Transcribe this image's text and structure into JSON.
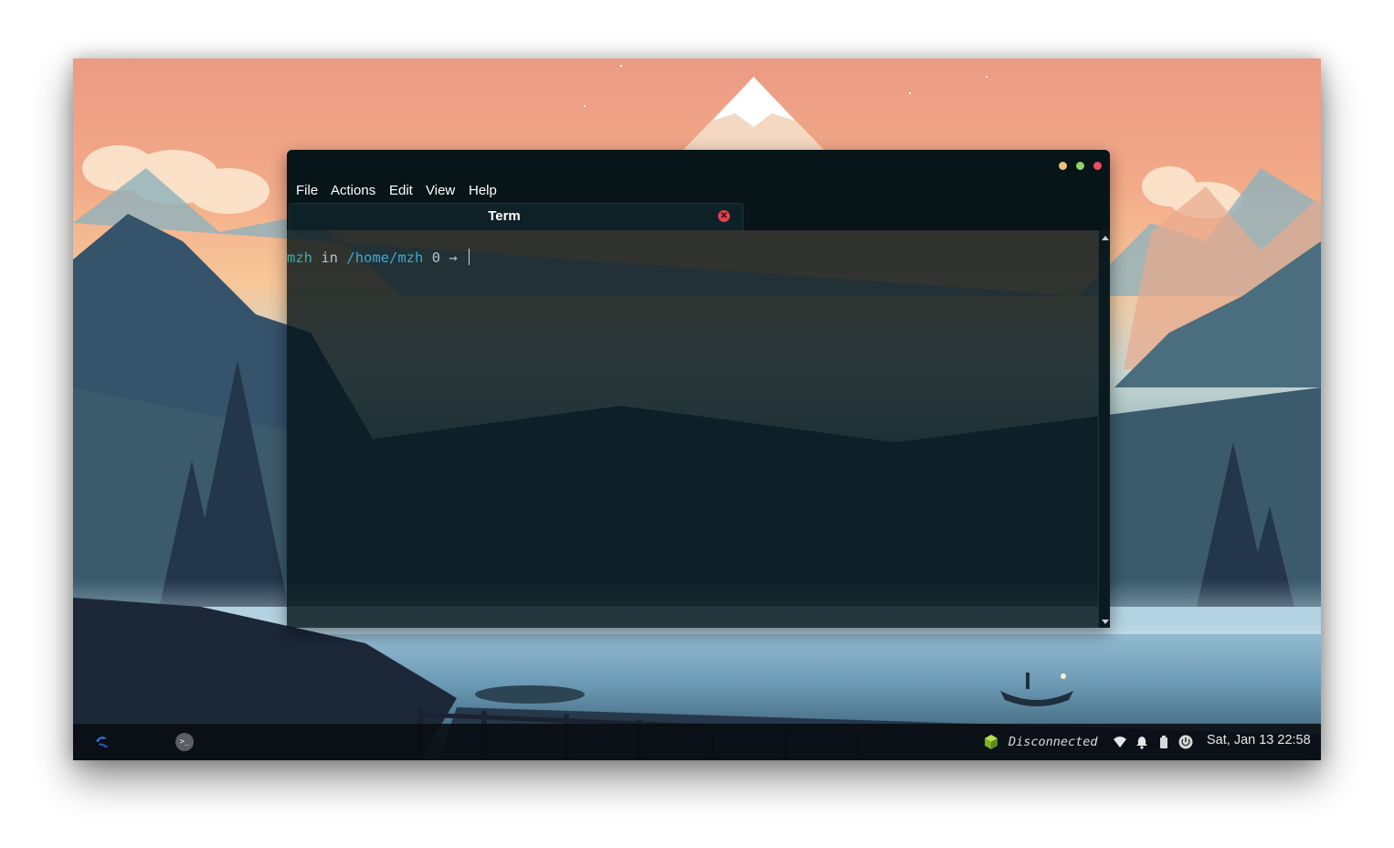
{
  "window": {
    "menu": [
      "File",
      "Actions",
      "Edit",
      "View",
      "Help"
    ],
    "tab": {
      "label": "Term"
    },
    "terminal": {
      "user": "mzh",
      "in_word": "in",
      "path": "/home/mzh",
      "exit_code": "0",
      "arrow": "→"
    }
  },
  "taskbar": {
    "network_status": "Disconnected",
    "clock": "Sat, Jan 13 22:58",
    "terminal_launcher_glyph": ">_"
  },
  "colors": {
    "terminal_user": "#35b0a8",
    "terminal_path": "#3fa9d6",
    "window_close": "#e8525c",
    "window_maximize": "#8fd16a",
    "window_minimize": "#e8c27a"
  }
}
